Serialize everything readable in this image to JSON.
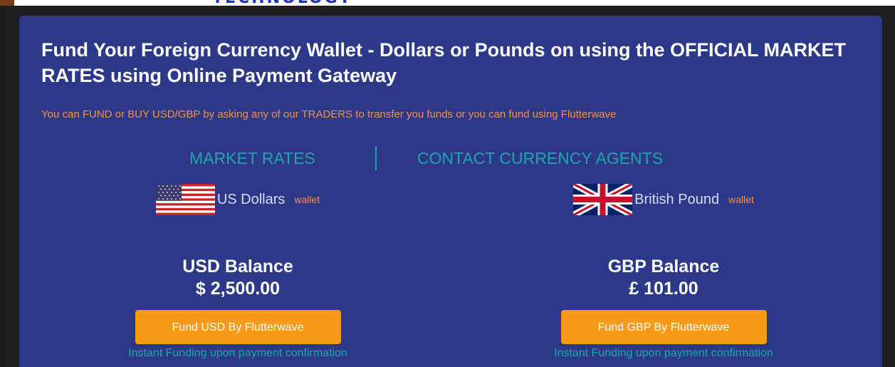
{
  "header": {
    "logo_text": "TECHNOLOGY"
  },
  "card": {
    "headline": "Fund Your Foreign Currency Wallet - Dollars or Pounds on using the OFFICIAL MARKET RATES using Online Payment Gateway",
    "subline": "You can FUND or BUY USD/GBP by asking any of our TRADERS to transfer you funds or you can fund using Flutterwave"
  },
  "tabs": {
    "market_rates": "MARKET RATES",
    "contact_agents": "CONTACT CURRENCY AGENTS"
  },
  "wallets": {
    "usd": {
      "name": "US Dollars",
      "tag": "wallet",
      "balance_label": "USD Balance",
      "balance_value": "$ 2,500.00",
      "button_label": "Fund USD By Flutterwave",
      "note": "Instant Funding upon payment confirmation",
      "icon": "us-flag-icon"
    },
    "gbp": {
      "name": "British Pound",
      "tag": "wallet",
      "balance_label": "GBP Balance",
      "balance_value": "£ 101.00",
      "button_label": "Fund GBP By Flutterwave",
      "note": "Instant Funding upon payment confirmation",
      "icon": "uk-flag-icon"
    }
  },
  "colors": {
    "card_bg": "#2d3889",
    "accent_orange": "#f7913c",
    "teal": "#1ea6a8",
    "button": "#f99a1a"
  }
}
